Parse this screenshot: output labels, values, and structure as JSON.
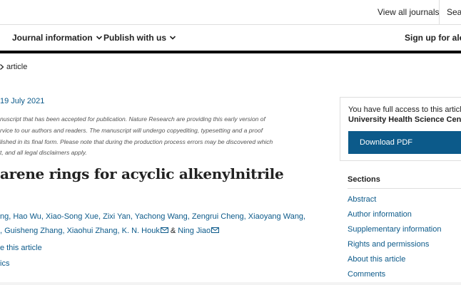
{
  "topbar": {
    "view_all": "View all journals",
    "search": "Search"
  },
  "nav": {
    "journal_info": "Journal information",
    "publish": "Publish with us",
    "signup": "Sign up for alerts"
  },
  "breadcrumb": {
    "current": "article"
  },
  "article": {
    "published": "19 July 2021",
    "notice": [
      "nuscript that has been accepted for publication. Nature Research are providing this early version of",
      "rvice to our authors and readers. The manuscript will undergo copyediting, typesetting and a proof",
      "lished in its final form. Please note that during the production process errors may be discovered which",
      "t, and all legal disclaimers apply."
    ],
    "title": "arene rings for acyclic alkenylnitrile",
    "authors_line1": [
      "ng,",
      "Hao Wu,",
      "Xiao-Song Xue,",
      "Zixi Yan,",
      "Yachong Wang,",
      "Zengrui Cheng,",
      "Xiaoyang Wang,"
    ],
    "authors_line2": [
      ",",
      "Guisheng Zhang,",
      "Xiaohui Zhang,",
      "K. N. Houk"
    ],
    "amp": "&",
    "last_author": "Ning Jiao",
    "cite": "e this article",
    "metrics": "ics"
  },
  "access": {
    "line1": "You have full access to this article via",
    "line2": "University Health Science Center",
    "pdf": "Download PDF"
  },
  "sections": {
    "heading": "Sections",
    "items": [
      "Abstract",
      "Author information",
      "Supplementary information",
      "Rights and permissions",
      "About this article",
      "Comments"
    ]
  },
  "colors": {
    "link": "#0c5a8a",
    "text": "#222222",
    "rule": "#000000"
  }
}
